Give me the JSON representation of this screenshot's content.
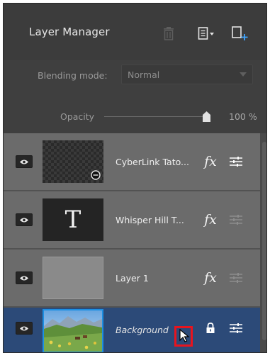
{
  "panel": {
    "title": "Layer Manager",
    "icons": [
      "trash-icon",
      "layer-menu-icon",
      "add-layer-icon"
    ]
  },
  "blending": {
    "label": "Blending mode:",
    "value": "Normal"
  },
  "opacity": {
    "label": "Opacity",
    "value_text": "100 %",
    "level": 1.0
  },
  "layers": [
    {
      "name": "CyberLink Tato...",
      "thumb": "transparent-checker",
      "selected": false,
      "has_fx": true,
      "adjust_active": true,
      "locked": false
    },
    {
      "name": "Whisper Hill  T...",
      "thumb": "text",
      "thumb_glyph": "T",
      "selected": false,
      "has_fx": true,
      "adjust_active": false,
      "locked": false
    },
    {
      "name": "Layer 1",
      "thumb": "gray",
      "selected": false,
      "has_fx": true,
      "adjust_active": false,
      "locked": false
    },
    {
      "name": "Background",
      "thumb": "photo",
      "selected": true,
      "has_fx": false,
      "adjust_active": true,
      "locked": true
    }
  ],
  "colors": {
    "panel_bg": "#3f3f3f",
    "layer_bg": "#6b6b6b",
    "selected_bg": "#2c4a78",
    "highlight_box": "#e8141e",
    "thumb_border_selected": "#1d8fe3"
  }
}
